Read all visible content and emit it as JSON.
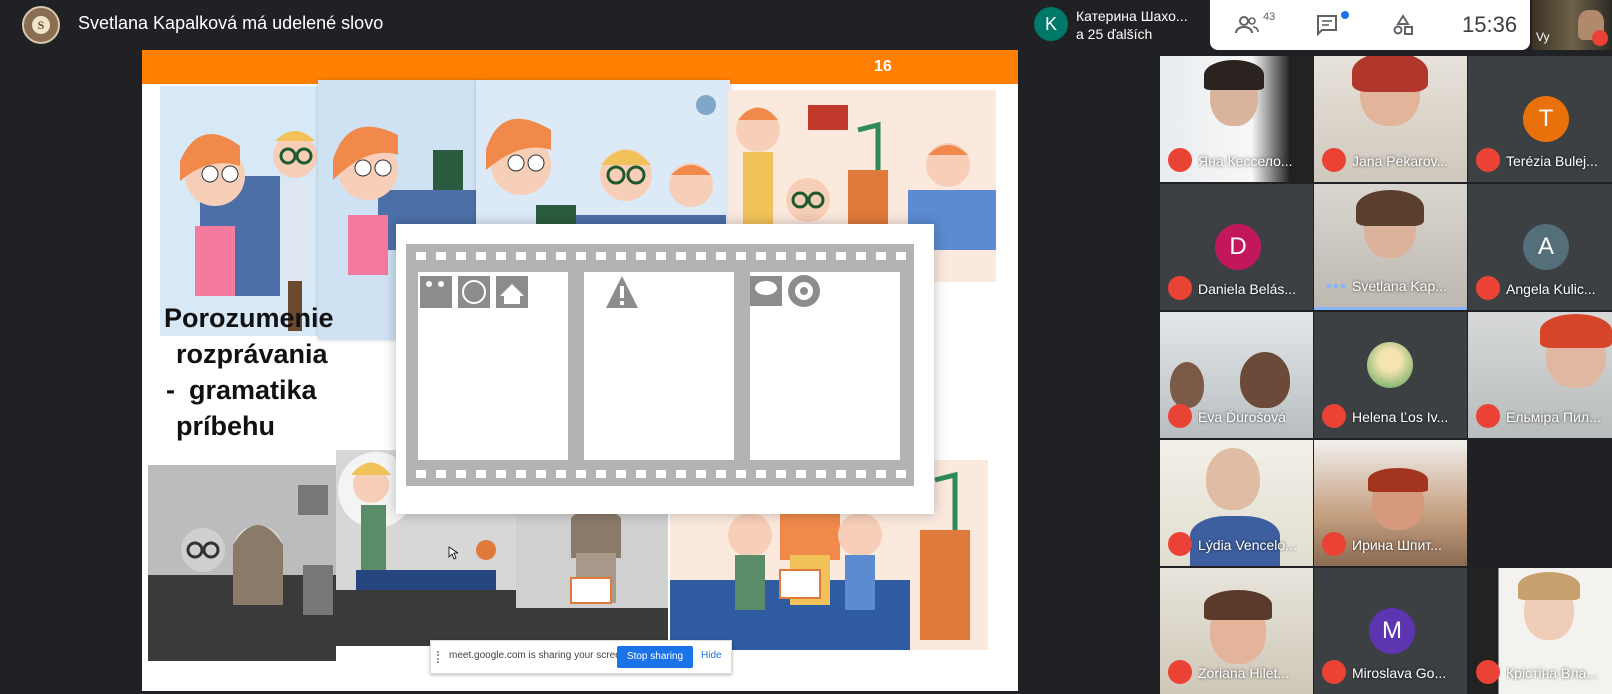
{
  "topbar": {
    "presenter_text": "Svetlana Kapalková má udelené slovo"
  },
  "presenting": {
    "avatar_letter": "K",
    "avatar_color": "#00796b",
    "line1": "Катерина Шахо...",
    "line2": "a 25 ďalších"
  },
  "controls": {
    "people_count": "43",
    "time": "15:36",
    "self_label": "Vy"
  },
  "slide": {
    "page_number": "16",
    "title_line1": "Porozumenie",
    "title_line2": "rozprávania",
    "bullet": "-",
    "title_line3": "gramatika",
    "title_line4": "príbehu"
  },
  "share_bar": {
    "text": "meet.google.com is sharing your screen.",
    "stop_label": "Stop sharing",
    "hide_label": "Hide"
  },
  "participants": [
    {
      "name": "Яна Кессело...",
      "type": "video"
    },
    {
      "name": "Jana Pekarov...",
      "type": "video"
    },
    {
      "name": "Terézia Bulej...",
      "type": "avatar",
      "letter": "T",
      "color": "#e8710a"
    },
    {
      "name": "Daniela Belás...",
      "type": "avatar",
      "letter": "D",
      "color": "#c2185b"
    },
    {
      "name": "Svetlana Kap...",
      "type": "video",
      "speaking": true
    },
    {
      "name": "Angela Kulic...",
      "type": "avatar",
      "letter": "A",
      "color": "#546e7a"
    },
    {
      "name": "Eva Ďurošová",
      "type": "video"
    },
    {
      "name": "Helena Ľos Iv...",
      "type": "photo"
    },
    {
      "name": "Ельміра Пил...",
      "type": "video"
    },
    {
      "name": "Lýdia Vencelo...",
      "type": "video"
    },
    {
      "name": "Ирина Шпит...",
      "type": "video"
    },
    {
      "name": "Zoriana Hilet...",
      "type": "video"
    },
    {
      "name": "Miroslava Go...",
      "type": "avatar",
      "letter": "M",
      "color": "#5e35b1"
    },
    {
      "name": "Крістіна Вла...",
      "type": "video"
    }
  ]
}
